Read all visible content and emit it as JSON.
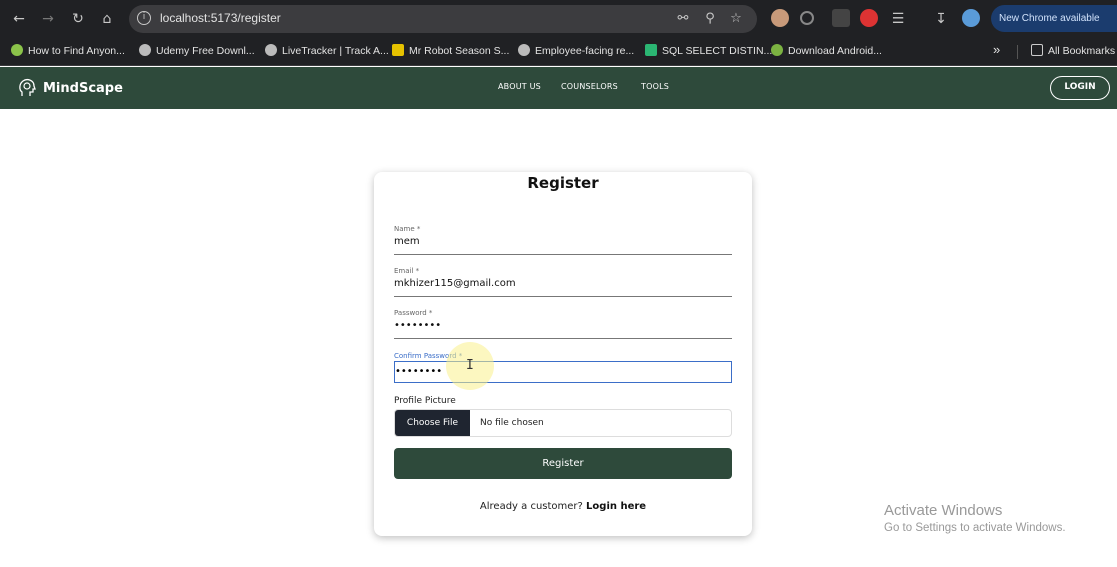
{
  "browser": {
    "url": "localhost:5173/register",
    "update_label": "New Chrome available",
    "bookmarks": [
      {
        "label": "How to Find Anyon..."
      },
      {
        "label": "Udemy Free Downl..."
      },
      {
        "label": "LiveTracker | Track A..."
      },
      {
        "label": "Mr Robot Season S..."
      },
      {
        "label": "Employee-facing re..."
      },
      {
        "label": "SQL SELECT DISTIN..."
      },
      {
        "label": "Download Android..."
      }
    ],
    "all_bookmarks_label": "All Bookmarks",
    "overflow_label": "»"
  },
  "app": {
    "brand": "MindScape",
    "nav": [
      "ABOUT US",
      "COUNSELORS",
      "TOOLS"
    ],
    "login_label": "LOGIN"
  },
  "form": {
    "title": "Register",
    "name": {
      "label": "Name *",
      "value": "mem"
    },
    "email": {
      "label": "Email *",
      "value": "mkhizer115@gmail.com"
    },
    "password": {
      "label": "Password *",
      "value": "••••••••"
    },
    "confirm": {
      "label": "Confirm Password *",
      "value": "••••••••"
    },
    "picture_label": "Profile Picture",
    "choose_file_label": "Choose File",
    "no_file_label": "No file chosen",
    "submit_label": "Register",
    "already_text": "Already a customer?",
    "login_here_label": "Login here"
  },
  "watermark": {
    "title": "Activate Windows",
    "subtitle": "Go to Settings to activate Windows."
  },
  "colors": {
    "brand_green": "#2e4a3b",
    "focus_blue": "#3b6ec8"
  }
}
